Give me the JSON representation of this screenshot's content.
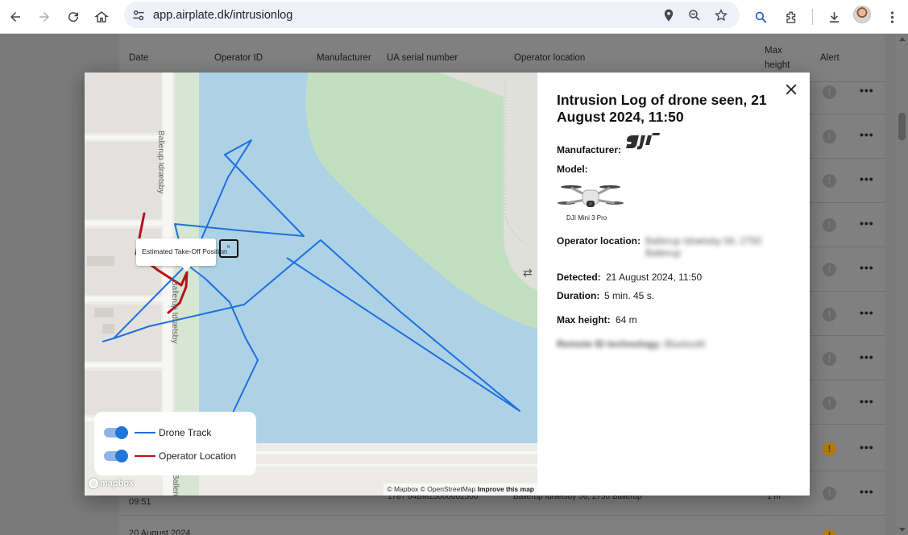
{
  "browser": {
    "url": "app.airplate.dk/intrusionlog"
  },
  "table": {
    "headers": [
      "Date",
      "Operator ID",
      "Manufacturer",
      "UA serial number",
      "Operator location",
      "Max height",
      "Alert"
    ],
    "max_height_line1": "Max",
    "max_height_line2": "height",
    "bottom_row": {
      "time": "09:51",
      "serial": "1787 04BM25000002500",
      "location": "Ballerup Idrætsby 56, 2750 Ballerup",
      "height": "1 m"
    },
    "next_row_date": "20 August 2024",
    "more_label": "•••"
  },
  "map": {
    "street_labels": [
      "Ballerup Idrætsby",
      "Ballerup Idrætsby",
      "Ballerup Idrætsby"
    ],
    "popup_text": "Estimated Take-Off Position",
    "popup_close": "×",
    "legend": {
      "drone_track_label": "Drone Track",
      "operator_location_label": "Operator Location",
      "drone_track_color": "#1f6fe0",
      "operator_color": "#b5121b",
      "drone_track_on": true,
      "operator_location_on": true
    },
    "logo": "mapbox",
    "attribution": {
      "mapbox": "© Mapbox",
      "osm": "© OpenStreetMap",
      "improve": "Improve this map"
    },
    "water_color": "#add2e6",
    "park_color": "#c2dfbf"
  },
  "info": {
    "title": "Intrusion Log of drone seen, 21 August 2024, 11:50",
    "manufacturer_label": "Manufacturer:",
    "manufacturer_logo": "dji",
    "model_label": "Model:",
    "model_caption": "DJI Mini 3 Pro",
    "operator_location_label": "Operator location:",
    "operator_location_value": "Ballerup Idrætsby 56, 2750 Ballerup",
    "detected_label": "Detected:",
    "detected_value": "21 August 2024, 11:50",
    "duration_label": "Duration:",
    "duration_value": "5 min. 45 s.",
    "max_height_label": "Max height:",
    "max_height_value": "64 m",
    "remote_id_label": "Remote ID technology:",
    "remote_id_value": "Bluetooth"
  }
}
